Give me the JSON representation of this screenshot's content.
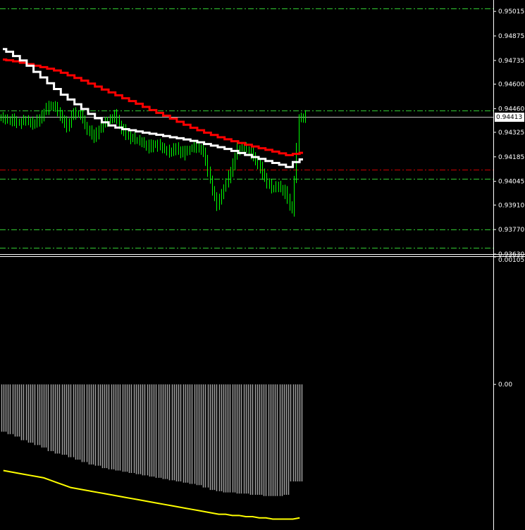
{
  "chart_data": [
    {
      "type": "candlestick",
      "panel": "main",
      "ylim": [
        0.9363,
        0.9508
      ],
      "yticks": [
        "0.95015",
        "0.94875",
        "0.94735",
        "0.94600",
        "0.94460",
        "0.94325",
        "0.94185",
        "0.94045",
        "0.93910",
        "0.93770",
        "0.93630"
      ],
      "current_price": "0.94413",
      "current_price_value": 0.94413,
      "colors": {
        "candles": "#00ff00",
        "ma_red": "#ff0000",
        "ma_white": "#ffffff",
        "level_green": "#33cc33",
        "level_red": "#cc0000",
        "bid_line": "#c0c0c0"
      },
      "series": [
        {
          "name": "",
          "type": "line",
          "color": "#ff0000",
          "values": [
            0.9474,
            0.94736,
            0.9473,
            0.94722,
            0.94714,
            0.94705,
            0.94697,
            0.94688,
            0.94678,
            0.94665,
            0.9465,
            0.94635,
            0.9462,
            0.94603,
            0.94586,
            0.94569,
            0.94553,
            0.94536,
            0.94519,
            0.94503,
            0.94488,
            0.9447,
            0.94452,
            0.94436,
            0.9442,
            0.94403,
            0.94385,
            0.94368,
            0.94351,
            0.94337,
            0.94323,
            0.9431,
            0.94297,
            0.94285,
            0.94274,
            0.94264,
            0.94254,
            0.94244,
            0.94234,
            0.94225,
            0.94215,
            0.94205,
            0.94195,
            0.94202,
            0.94208
          ]
        },
        {
          "name": "",
          "type": "line",
          "color": "#ffffff",
          "values": [
            0.948,
            0.94785,
            0.9476,
            0.94735,
            0.94705,
            0.9467,
            0.94638,
            0.94605,
            0.94572,
            0.9454,
            0.94512,
            0.94485,
            0.94458,
            0.9443,
            0.94405,
            0.94382,
            0.94364,
            0.94352,
            0.94343,
            0.94337,
            0.9433,
            0.94323,
            0.94317,
            0.94311,
            0.94304,
            0.94297,
            0.94291,
            0.94284,
            0.94276,
            0.94268,
            0.94258,
            0.94249,
            0.9424,
            0.9423,
            0.94219,
            0.94207,
            0.94196,
            0.94184,
            0.94173,
            0.94161,
            0.9415,
            0.9414,
            0.94127,
            0.94155,
            0.9417
          ]
        },
        {
          "name": "",
          "type": "candles",
          "color": "#00ff00",
          "close": [
            0.944,
            0.94395,
            0.9438,
            0.9439,
            0.9437,
            0.94405,
            0.9446,
            0.9448,
            0.9442,
            0.9436,
            0.9444,
            0.9442,
            0.9434,
            0.943,
            0.9436,
            0.9439,
            0.9442,
            0.9435,
            0.943,
            0.9428,
            0.9427,
            0.9424,
            0.9426,
            0.9423,
            0.9421,
            0.9424,
            0.942,
            0.9423,
            0.9424,
            0.9422,
            0.9405,
            0.939,
            0.9401,
            0.941,
            0.9423,
            0.9424,
            0.942,
            0.9415,
            0.9406,
            0.94,
            0.9402,
            0.9398,
            0.9388,
            0.944,
            0.94413
          ]
        }
      ],
      "levels": [
        {
          "value": 0.9503,
          "color": "#33cc33",
          "style": "dashdot"
        },
        {
          "value": 0.9445,
          "color": "#33cc33",
          "style": "dashdot"
        },
        {
          "value": 0.94413,
          "color": "#c0c0c0",
          "style": "solid"
        },
        {
          "value": 0.9411,
          "color": "#cc0000",
          "style": "dashdot"
        },
        {
          "value": 0.9406,
          "color": "#33cc33",
          "style": "dashdot"
        },
        {
          "value": 0.9377,
          "color": "#33cc33",
          "style": "dashdot"
        },
        {
          "value": 0.93665,
          "color": "#33cc33",
          "style": "dashdot"
        }
      ]
    },
    {
      "type": "bar",
      "panel": "indicator",
      "yticks": [
        "0.001051",
        "0.00"
      ],
      "ylim": [
        -0.0012,
        0.001051
      ],
      "colors": {
        "bars": "#a0a0a0",
        "signal": "#ffff00"
      },
      "series": [
        {
          "name": "",
          "type": "bar",
          "color": "#a0a0a0",
          "values": [
            -0.00039,
            -0.00041,
            -0.00043,
            -0.00046,
            -0.00048,
            -0.0005,
            -0.00052,
            -0.00055,
            -0.00057,
            -0.00058,
            -0.0006,
            -0.00062,
            -0.00064,
            -0.00066,
            -0.00067,
            -0.00069,
            -0.0007,
            -0.00071,
            -0.00072,
            -0.00073,
            -0.00074,
            -0.00075,
            -0.00076,
            -0.00077,
            -0.00078,
            -0.00079,
            -0.0008,
            -0.00081,
            -0.00082,
            -0.00083,
            -0.00085,
            -0.00087,
            -0.00088,
            -0.00089,
            -0.00089,
            -0.0009,
            -0.0009,
            -0.00091,
            -0.00091,
            -0.00092,
            -0.00092,
            -0.00092,
            -0.00091,
            -0.0008,
            -0.0008
          ]
        },
        {
          "name": "",
          "type": "line",
          "color": "#ffff00",
          "values": [
            -0.00071,
            -0.00072,
            -0.00073,
            -0.00074,
            -0.00075,
            -0.00076,
            -0.00077,
            -0.00079,
            -0.00081,
            -0.00083,
            -0.00085,
            -0.00086,
            -0.00087,
            -0.00088,
            -0.00089,
            -0.0009,
            -0.00091,
            -0.00092,
            -0.00093,
            -0.00094,
            -0.00095,
            -0.00096,
            -0.00097,
            -0.00098,
            -0.00099,
            -0.001,
            -0.00101,
            -0.00102,
            -0.00103,
            -0.00104,
            -0.00105,
            -0.00106,
            -0.00107,
            -0.00107,
            -0.00108,
            -0.00108,
            -0.00109,
            -0.00109,
            -0.0011,
            -0.0011,
            -0.00111,
            -0.00111,
            -0.00111,
            -0.00111,
            -0.0011
          ]
        }
      ]
    }
  ]
}
